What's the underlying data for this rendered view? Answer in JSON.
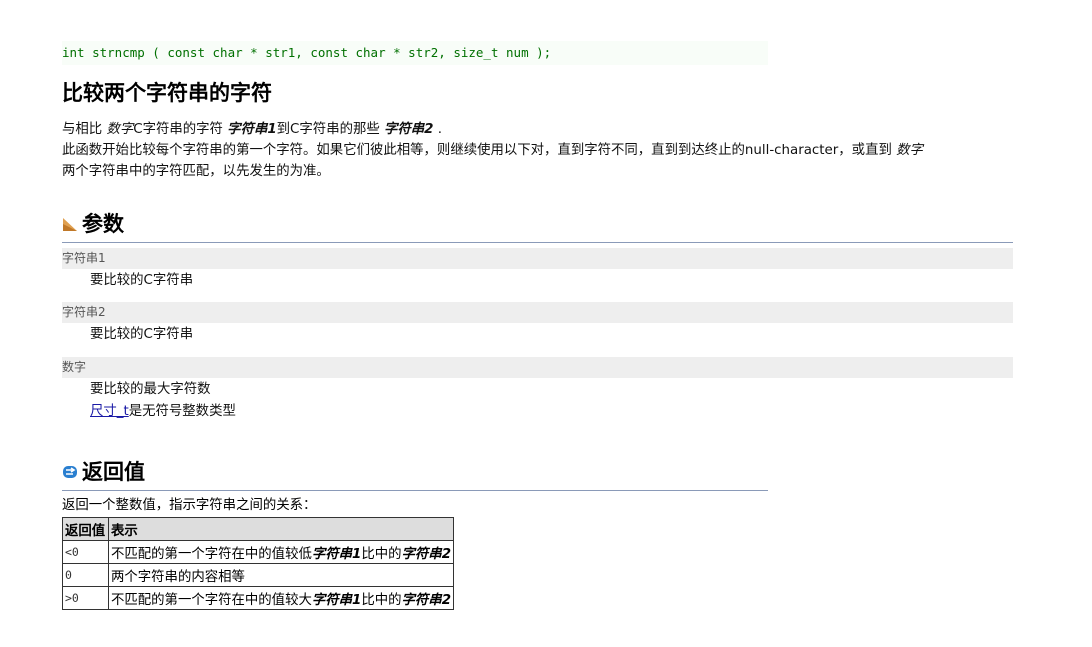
{
  "prototype": "int strncmp ( const char * str1, const char * str2, size_t num );",
  "title": "比较两个字符串的字符",
  "description": {
    "line1": {
      "t1": "与相比 ",
      "i1": "数字",
      "t2": "C字符串的字符 ",
      "i2": "字符串1",
      "t3": "到C字符串的那些 ",
      "i3": "字符串2",
      "t4": " ."
    },
    "line2": {
      "t1": "此函数开始比较每个字符串的第一个字符。如果它们彼此相等，则继续使用以下对，直到字符不同，直到到达终止的null-character，或直到 ",
      "i1": "数字"
    },
    "line3": "两个字符串中的字符匹配，以先发生的为准。"
  },
  "params": {
    "heading": "参数",
    "items": [
      {
        "term": "字符串1",
        "def": "要比较的C字符串"
      },
      {
        "term": "字符串2",
        "def": "要比较的C字符串"
      },
      {
        "term": "数字",
        "def": "要比较的最大字符数",
        "link": "尺寸_t",
        "link_suffix": "是无符号整数类型"
      }
    ]
  },
  "returns": {
    "heading": "返回值",
    "intro": "返回一个整数值，指示字符串之间的关系：",
    "table": {
      "headers": [
        "返回值",
        "表示"
      ],
      "rows": [
        {
          "code": "<0",
          "t1": "不匹配的第一个字符在中的值较低",
          "i1": "字符串1",
          "t2": "比中的",
          "i2": "字符串2"
        },
        {
          "code": "0",
          "t1": "两个字符串的内容相等"
        },
        {
          "code": ">0",
          "t1": "不匹配的第一个字符在中的值较大",
          "i1": "字符串1",
          "t2": "比中的",
          "i2": "字符串2"
        }
      ]
    }
  },
  "icons": {
    "params": "triangle-icon",
    "returns": "return-arrow-icon"
  },
  "colors": {
    "code_green": "#007000",
    "link": "#1a1aa6",
    "rule": "#8a9ab8"
  }
}
